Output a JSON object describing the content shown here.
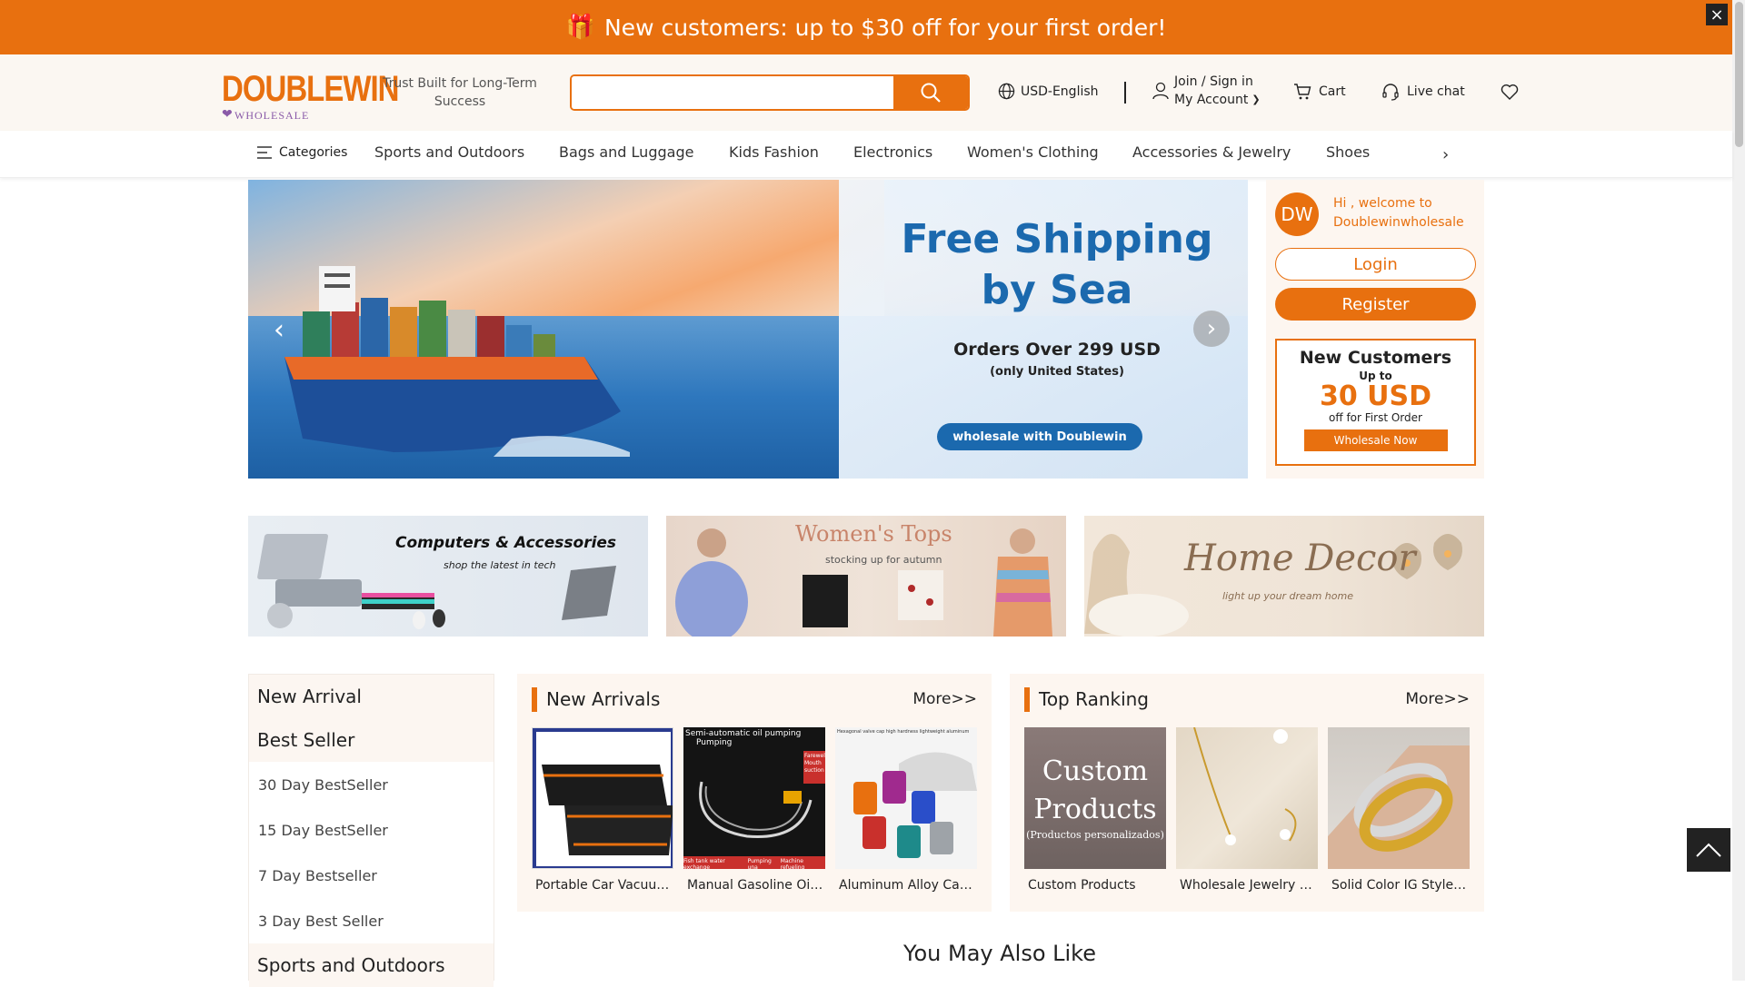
{
  "promo": {
    "gift_icon": "gift-icon",
    "text": "New customers: up to $30 off for your first order!",
    "close": "×"
  },
  "header": {
    "logo_main": "DOUBLEWIN",
    "logo_sub": "WHOLESALE",
    "tagline": "Trust Built for Long-Term Success",
    "search_placeholder": "",
    "currency": "USD-English",
    "join": "Join / Sign in",
    "account": "My Account",
    "cart": "Cart",
    "live_chat": "Live chat"
  },
  "nav": {
    "categories": "Categories",
    "links": [
      "Sports and Outdoors",
      "Bags and Luggage",
      "Kids Fashion",
      "Electronics",
      "Women's Clothing",
      "Accessories & Jewelry",
      "Shoes"
    ]
  },
  "hero": {
    "title_line1": "Free Shipping",
    "title_line2": "by Sea",
    "orders": "Orders Over 299 USD",
    "only": "(only United States)",
    "cta": "wholesale with Doublewin"
  },
  "welcome": {
    "avatar": "DW",
    "greeting": "Hi , welcome to Doublewinwholesale",
    "login": "Login",
    "register": "Register",
    "nc_title": "New Customers",
    "nc_upto": "Up to",
    "nc_amount": "30 USD",
    "nc_off": "off for First Order",
    "nc_button": "Wholesale Now"
  },
  "banners": [
    {
      "title": "Computers & Accessories",
      "sub": "shop the latest in tech"
    },
    {
      "title": "Women's Tops",
      "sub": "stocking up for autumn"
    },
    {
      "title": "Home Decor",
      "sub": "light up your dream home"
    }
  ],
  "sidebar": {
    "new_arrival": "New Arrival",
    "best_seller": "Best Seller",
    "items": [
      "30 Day BestSeller",
      "15 Day BestSeller",
      "7 Day Bestseller",
      "3 Day Best Seller"
    ],
    "sports": "Sports and Outdoors"
  },
  "new_arrivals": {
    "title": "New Arrivals",
    "more": "More>>",
    "products": [
      "Portable Car Vacuum Cleaner Bag",
      "Manual Gasoline Oil Pump",
      "Aluminum Alloy Car Valve Caps"
    ],
    "img_text_pump_1": "Semi-automatic oil pumping",
    "img_text_pump_2": "Pumping",
    "img_text_pump_3": "Farewell Mouth suction",
    "img_text_pump_4": "Fish tank water exchange",
    "img_text_pump_5": "Pumping una",
    "img_text_pump_6": "Machine refueling",
    "img_text_caps": "Hexagonal valve cap high hardness lightweight aluminum"
  },
  "top_ranking": {
    "title": "Top Ranking",
    "more": "More>>",
    "products": [
      "Custom Products",
      "Wholesale Jewelry Set",
      "Solid Color IG Style Bangle"
    ],
    "custom_img_line1": "Custom",
    "custom_img_line2": "Products",
    "custom_img_line3": "(Productos personalizados)"
  },
  "you_may_also_like": "You May Also Like"
}
